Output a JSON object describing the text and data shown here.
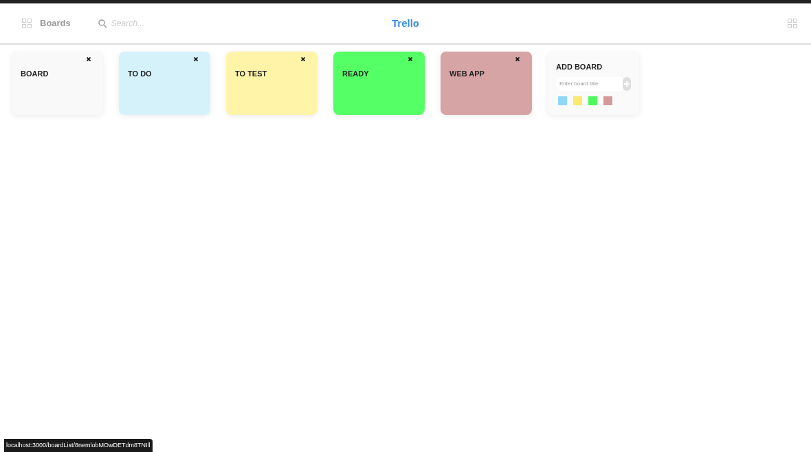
{
  "header": {
    "boards_label": "Boards",
    "search_placeholder": "Search...",
    "title": "Trello"
  },
  "boards": [
    {
      "title": "BOARD",
      "color": "#f9f9f9"
    },
    {
      "title": "TO DO",
      "color": "#d5f2fb"
    },
    {
      "title": "TO TEST",
      "color": "#fff4a8"
    },
    {
      "title": "READY",
      "color": "#55ff66"
    },
    {
      "title": "WEB APP",
      "color": "#d6a4a4"
    }
  ],
  "add_board": {
    "title": "ADD BOARD",
    "placeholder": "Enter board title",
    "swatches": [
      {
        "color": "#8fd8f5"
      },
      {
        "color": "#fde870"
      },
      {
        "color": "#4dfa5c"
      },
      {
        "color": "#d49a9a"
      }
    ]
  },
  "status_url": "localhost:3000/boardList/8nemlobMOwDETdm8TNIll"
}
